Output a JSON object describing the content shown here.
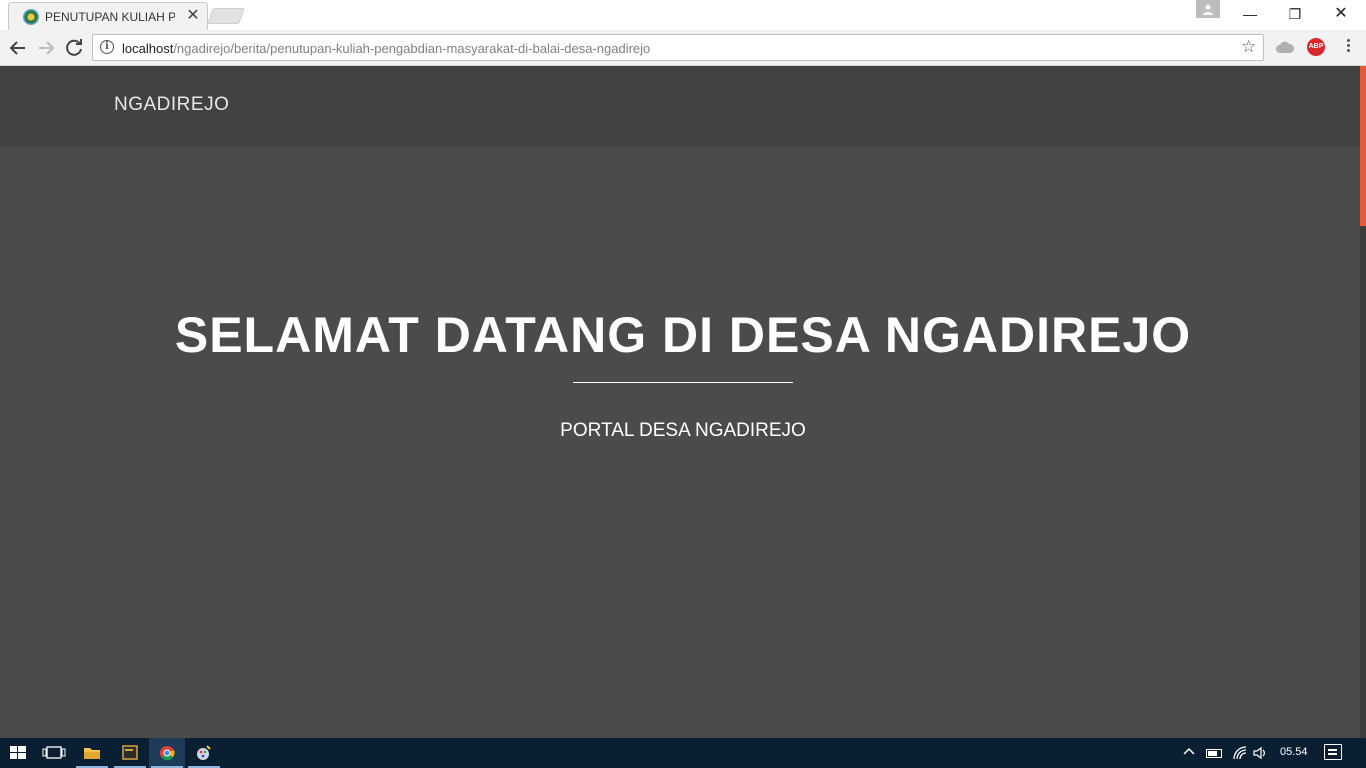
{
  "browser": {
    "tab_title": "PENUTUPAN KULIAH PEN",
    "url_host": "localhost",
    "url_path": "/ngadirejo/berita/penutupan-kuliah-pengabdian-masyarakat-di-balai-desa-ngadirejo",
    "tab_close": "✕",
    "star": "☆",
    "ext_abp": "ABP",
    "win_min": "—",
    "win_max": "❐",
    "win_close": "✕"
  },
  "page": {
    "brand": "NGADIREJO",
    "hero_title": "SELAMAT DATANG DI DESA NGADIREJO",
    "hero_subtitle": "PORTAL DESA NGADIREJO",
    "accent": "#e55a3c",
    "navbar_bg": "#424242",
    "hero_bg": "#4b4b4b"
  },
  "taskbar": {
    "clock": "05.54",
    "chevron": "^",
    "apps": [
      "start",
      "task-view",
      "file-explorer",
      "terminal",
      "chrome",
      "paint"
    ]
  }
}
